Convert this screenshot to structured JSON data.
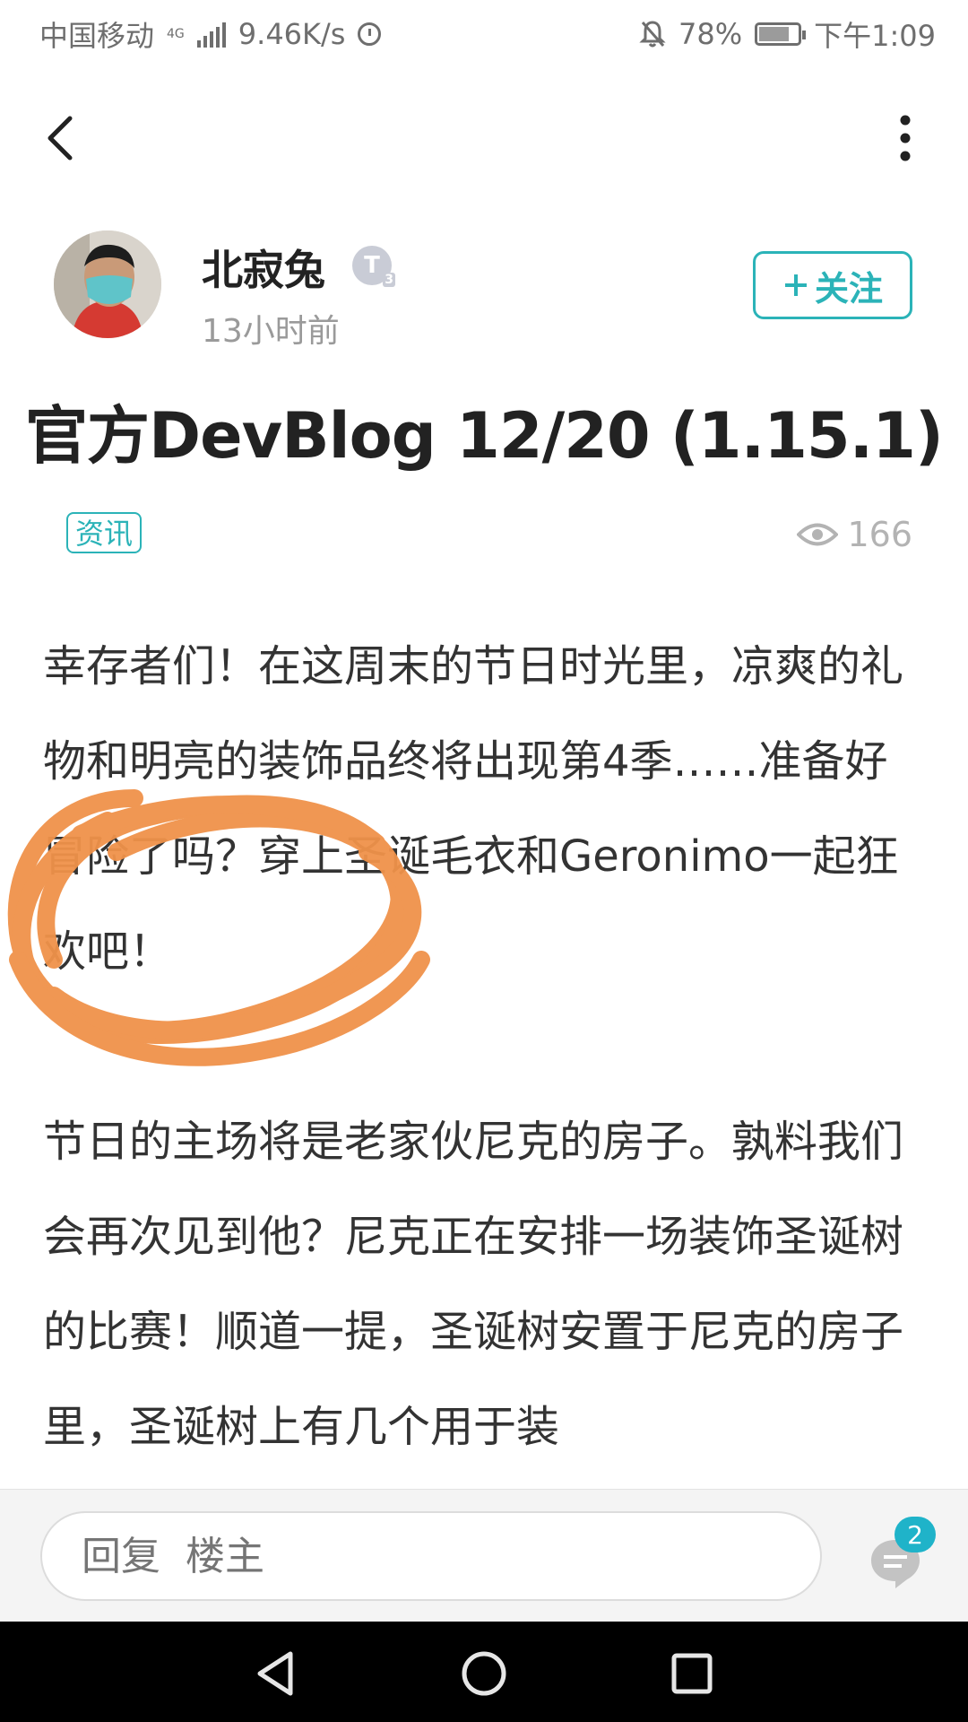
{
  "status_bar": {
    "carrier": "中国移动",
    "network": "4G",
    "speed": "9.46K/s",
    "battery": "78%",
    "battery_level": 0.78,
    "time": "下午1:09"
  },
  "post": {
    "author": {
      "name": "北寂兔",
      "level_badge": "T",
      "level_sub": "3",
      "time_ago": "13小时前"
    },
    "follow_label": "关注",
    "title": "官方DevBlog 12/20 (1.15.1)",
    "tag": "资讯",
    "views": "166",
    "paragraphs": [
      "幸存者们！在这周末的节日时光里，凉爽的礼物和明亮的装饰品终将出现第4季……准备好冒险了吗？穿上圣诞毛衣和Geronimo一起狂欢吧！",
      "节日的主场将是老家伙尼克的房子。孰料我们会再次见到他？尼克正在安排一场装饰圣诞树的比赛！顺道一提，圣诞树安置于尼克的房子里，圣诞树上有几个用于装"
    ]
  },
  "reply": {
    "placeholder": "回复  楼主",
    "comment_count": "2"
  },
  "icons": {
    "back": "back-arrow-icon",
    "more": "more-vertical-icon",
    "views": "eye-icon",
    "comments": "comment-icon",
    "nav_back": "triangle-back-icon",
    "nav_home": "circle-home-icon",
    "nav_recent": "square-recent-icon"
  },
  "colors": {
    "accent": "#2bb3b8",
    "badge": "#1fb3c9",
    "scribble": "#f0924a"
  }
}
